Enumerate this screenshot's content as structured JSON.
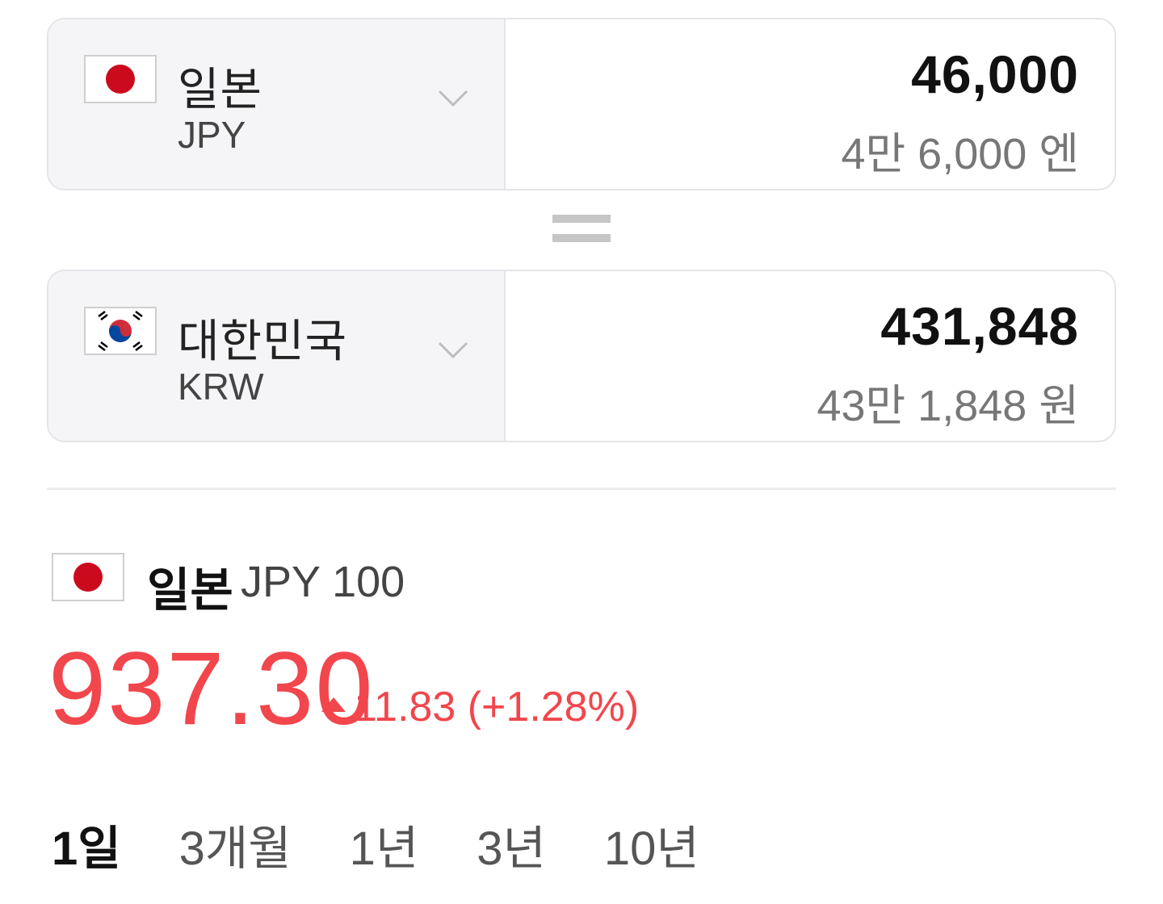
{
  "converter": {
    "from": {
      "country": "일본",
      "code": "JPY",
      "amount": "46,000",
      "amount_words": "4만 6,000 엔"
    },
    "to": {
      "country": "대한민국",
      "code": "KRW",
      "amount": "431,848",
      "amount_words": "43만 1,848 원"
    }
  },
  "rate": {
    "country": "일본",
    "unit": "JPY 100",
    "value": "937.30",
    "change": "11.83 (+1.28%)",
    "direction": "up",
    "color": "#f1464c"
  },
  "periods": [
    {
      "label": "1일",
      "active": true
    },
    {
      "label": "3개월",
      "active": false
    },
    {
      "label": "1년",
      "active": false
    },
    {
      "label": "3년",
      "active": false
    },
    {
      "label": "10년",
      "active": false
    }
  ]
}
